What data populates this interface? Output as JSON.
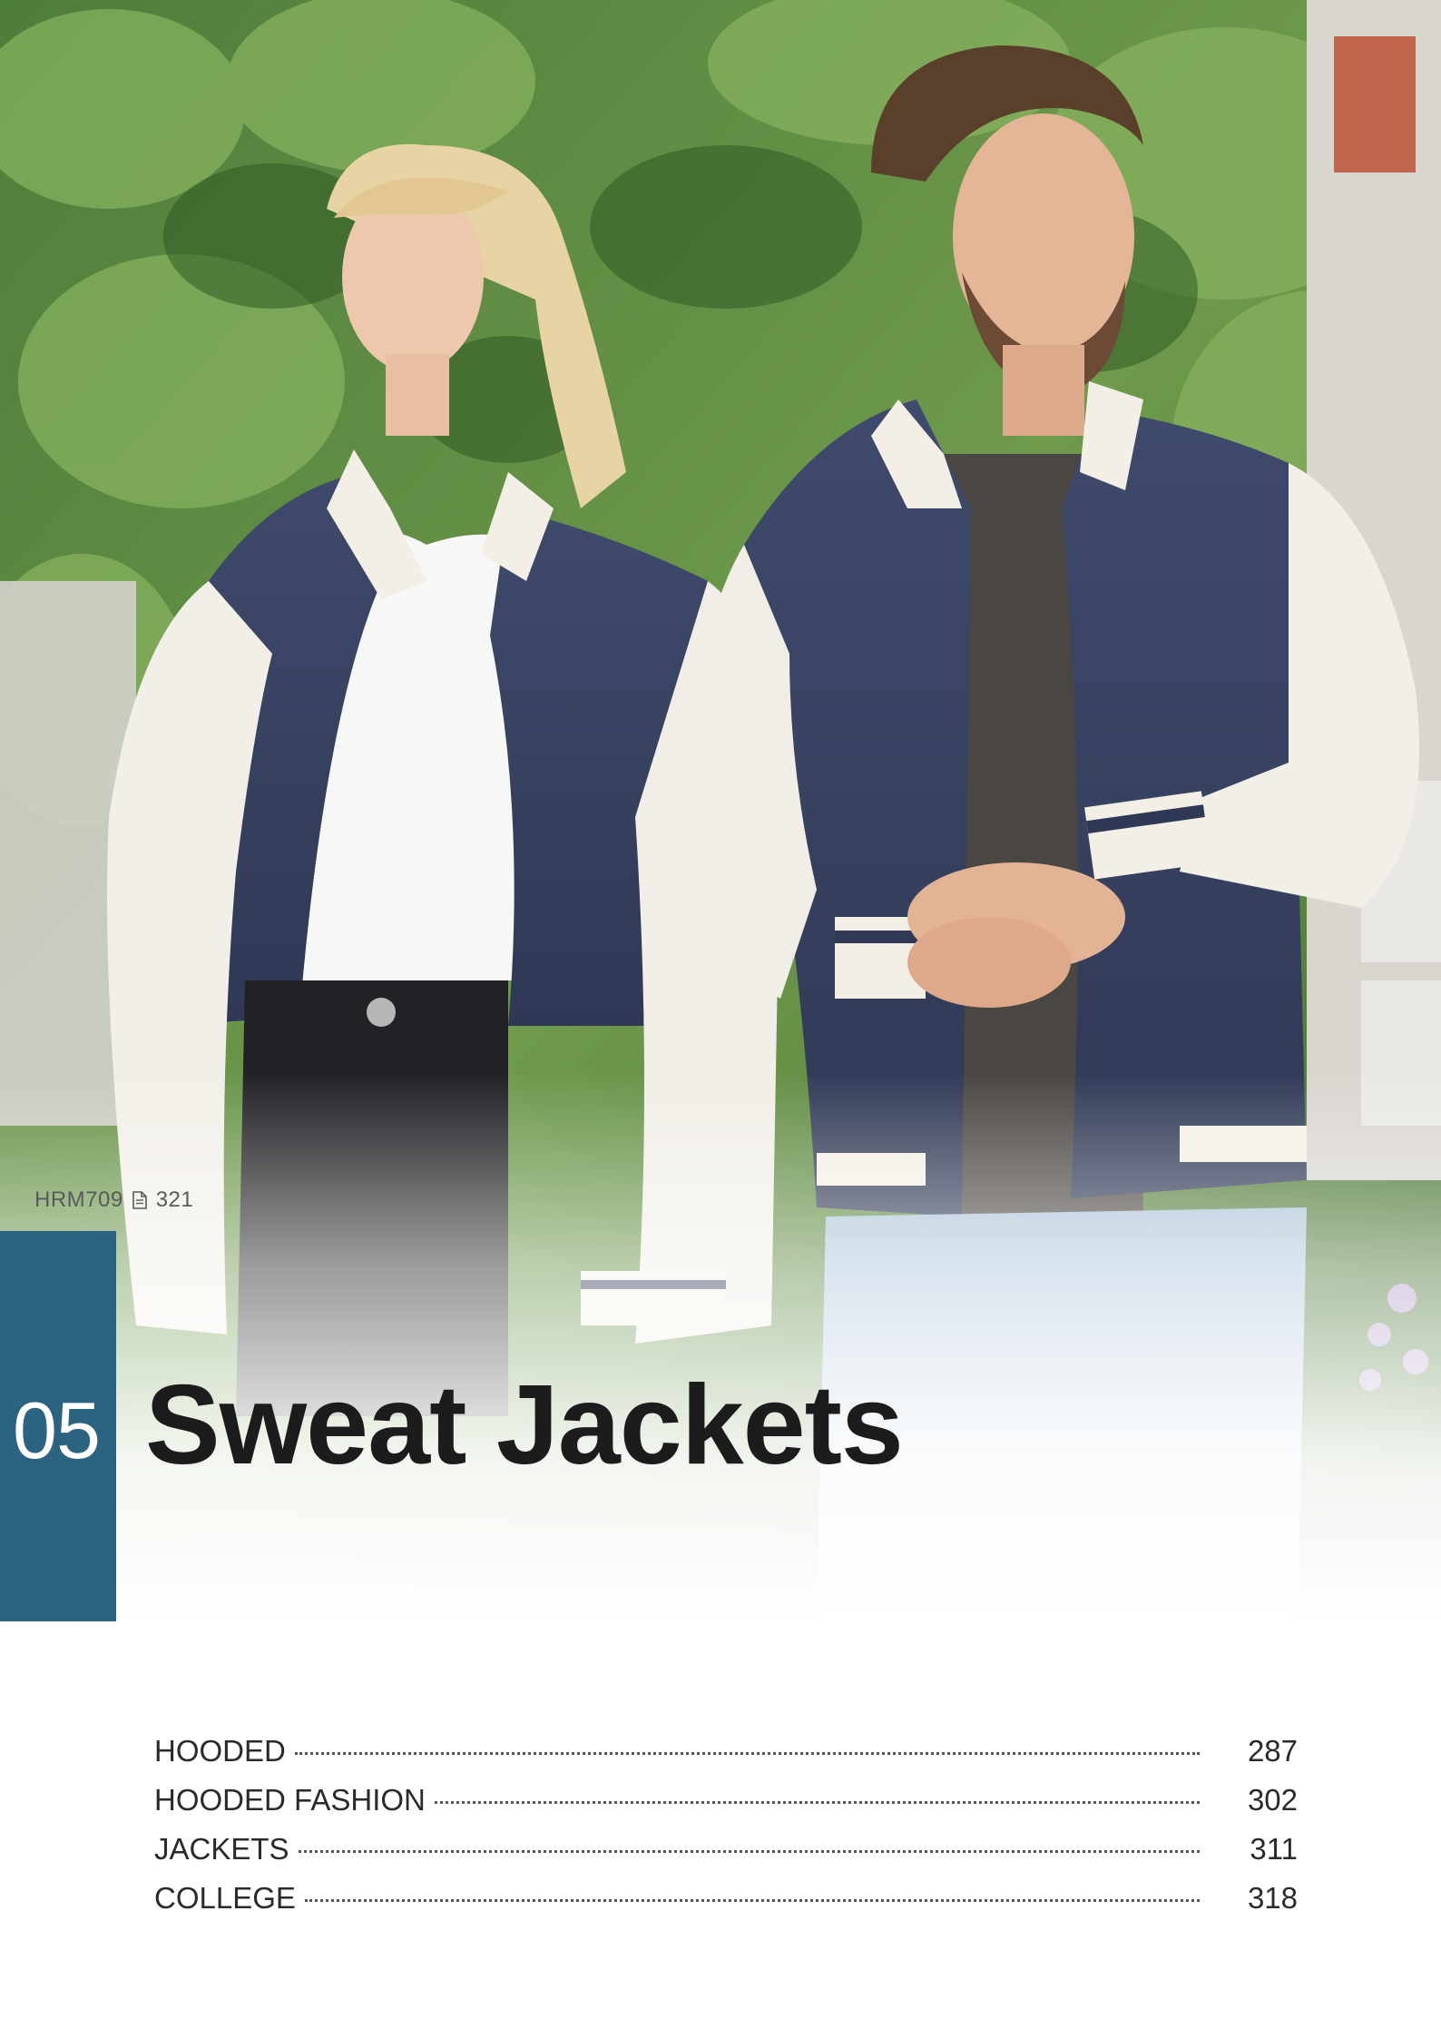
{
  "hero": {
    "image": "two-models-wearing-college-sweat-jackets-photo"
  },
  "product_ref": {
    "code": "HRM709",
    "icon": "document-icon",
    "page": "321"
  },
  "chapter": {
    "number": "05",
    "title": "Sweat Jackets",
    "color": "#2c6381"
  },
  "toc": [
    {
      "label": "HOODED",
      "page": "287"
    },
    {
      "label": "HOODED FASHION",
      "page": "302"
    },
    {
      "label": "JACKETS",
      "page": "311"
    },
    {
      "label": "COLLEGE",
      "page": "318"
    }
  ]
}
